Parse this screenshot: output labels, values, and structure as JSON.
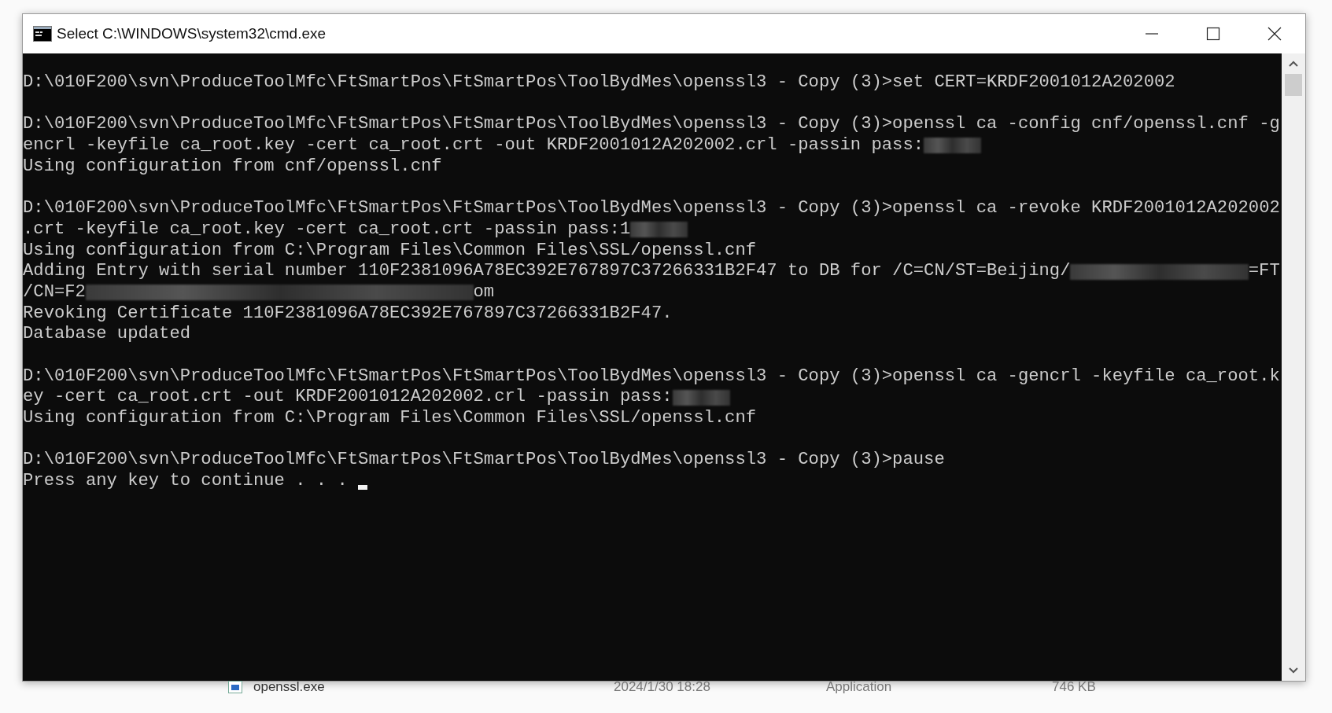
{
  "window": {
    "title": "Select C:\\WINDOWS\\system32\\cmd.exe"
  },
  "console": {
    "blocks": [
      {
        "lines": [
          {
            "parts": [
              "D:\\010F200\\svn\\ProduceToolMfc\\FtSmartPos\\FtSmartPos\\ToolBydMes\\openssl3 - Copy (3)>set CERT=KRDF2001012A202002"
            ],
            "redacted_end": false
          }
        ]
      },
      {
        "lines": [
          {
            "parts": [
              "D:\\010F200\\svn\\ProduceToolMfc\\FtSmartPos\\FtSmartPos\\ToolBydMes\\openssl3 - Copy (3)>openssl ca -config cnf/openssl.cnf -g"
            ],
            "redacted_end": false
          },
          {
            "parts": [
              "encrl -keyfile ca_root.key -cert ca_root.crt -out KRDF2001012A202002.crl -passin pass:"
            ],
            "redacted_end": true
          },
          {
            "parts": [
              "Using configuration from cnf/openssl.cnf"
            ],
            "redacted_end": false
          }
        ]
      },
      {
        "lines": [
          {
            "parts": [
              "D:\\010F200\\svn\\ProduceToolMfc\\FtSmartPos\\FtSmartPos\\ToolBydMes\\openssl3 - Copy (3)>openssl ca -revoke KRDF2001012A202002"
            ],
            "redacted_end": false
          },
          {
            "parts": [
              ".crt -keyfile ca_root.key -cert ca_root.crt -passin pass:1"
            ],
            "redacted_end": true
          },
          {
            "parts": [
              "Using configuration from C:\\Program Files\\Common Files\\SSL/openssl.cnf"
            ],
            "redacted_end": false
          },
          {
            "parts": [
              "Adding Entry with serial number 110F2381096A78EC392E767897C37266331B2F47 to DB for /C=CN/ST=Beijing/",
              "=FT"
            ],
            "redacted_end": false
          },
          {
            "parts": [
              "/CN=F2",
              "om"
            ],
            "redacted_end": false
          },
          {
            "parts": [
              "Revoking Certificate 110F2381096A78EC392E767897C37266331B2F47."
            ],
            "redacted_end": false
          },
          {
            "parts": [
              "Database updated"
            ],
            "redacted_end": false
          }
        ]
      },
      {
        "lines": [
          {
            "parts": [
              "D:\\010F200\\svn\\ProduceToolMfc\\FtSmartPos\\FtSmartPos\\ToolBydMes\\openssl3 - Copy (3)>openssl ca -gencrl -keyfile ca_root.k"
            ],
            "redacted_end": false
          },
          {
            "parts": [
              "ey -cert ca_root.crt -out KRDF2001012A202002.crl -passin pass:"
            ],
            "redacted_end": true
          },
          {
            "parts": [
              "Using configuration from C:\\Program Files\\Common Files\\SSL/openssl.cnf"
            ],
            "redacted_end": false
          }
        ]
      },
      {
        "lines": [
          {
            "parts": [
              "D:\\010F200\\svn\\ProduceToolMfc\\FtSmartPos\\FtSmartPos\\ToolBydMes\\openssl3 - Copy (3)>pause"
            ],
            "redacted_end": false
          },
          {
            "parts": [
              "Press any key to continue . . . "
            ],
            "redacted_end": false,
            "cursor": true
          }
        ]
      }
    ]
  },
  "background_file": {
    "name": "openssl.exe",
    "modified": "2024/1/30 18:28",
    "type": "Application",
    "size": "746 KB"
  }
}
